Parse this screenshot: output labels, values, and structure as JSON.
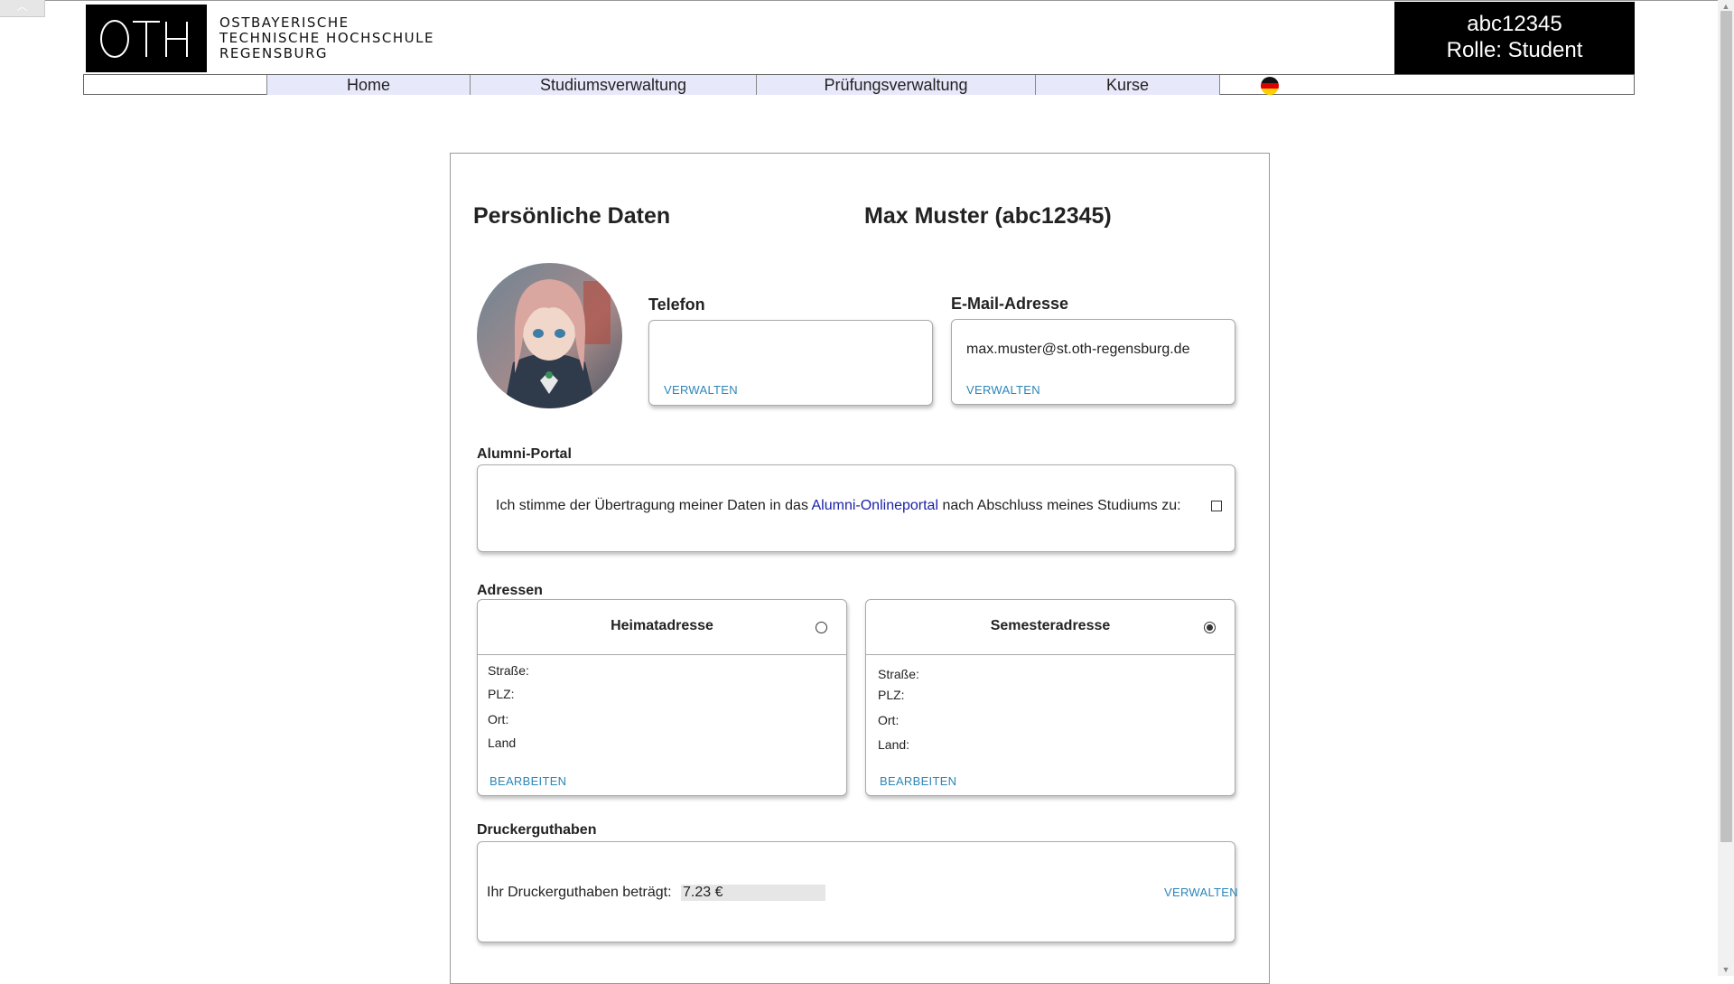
{
  "header": {
    "logo_text": "OTH",
    "institution_lines": [
      "OSTBAYERISCHE",
      "TECHNISCHE HOCHSCHULE",
      "REGENSBURG"
    ],
    "user_id": "abc12345",
    "role": "Rolle: Student"
  },
  "nav": {
    "items": [
      "Home",
      "Studiumsverwaltung",
      "Prüfungsverwaltung",
      "Kurse"
    ],
    "language_icon": "german-flag-icon"
  },
  "profile": {
    "section_title": "Persönliche Daten",
    "name_line": "Max Muster (abc12345)",
    "phone": {
      "label": "Telefon",
      "value": "",
      "action": "VERWALTEN"
    },
    "email": {
      "label": "E-Mail-Adresse",
      "value": "max.muster@st.oth-regensburg.de",
      "action": "VERWALTEN"
    }
  },
  "alumni": {
    "label": "Alumni-Portal",
    "text_before": "Ich stimme der Übertragung meiner Daten in das ",
    "link": "Alumni-Onlineportal",
    "text_after": " nach Abschluss meines Studiums zu:",
    "checked": false
  },
  "addresses": {
    "label": "Adressen",
    "home": {
      "title": "Heimatadresse",
      "selected": false,
      "fields": [
        "Straße:",
        "PLZ:",
        "Ort:",
        "Land"
      ],
      "action": "BEARBEITEN"
    },
    "semester": {
      "title": "Semesteradresse",
      "selected": true,
      "fields": [
        "Straße:",
        "PLZ:",
        "Ort:",
        "Land:"
      ],
      "action": "BEARBEITEN"
    }
  },
  "printer": {
    "label": "Druckerguthaben",
    "text": "Ihr Druckerguthaben beträgt:",
    "balance": "7.23 €",
    "action": "VERWALTEN"
  },
  "colors": {
    "nav_background": "#e8e8fb",
    "link_blue": "#2a86b8",
    "alumni_link": "#1a22a8",
    "header_black": "#000000"
  }
}
